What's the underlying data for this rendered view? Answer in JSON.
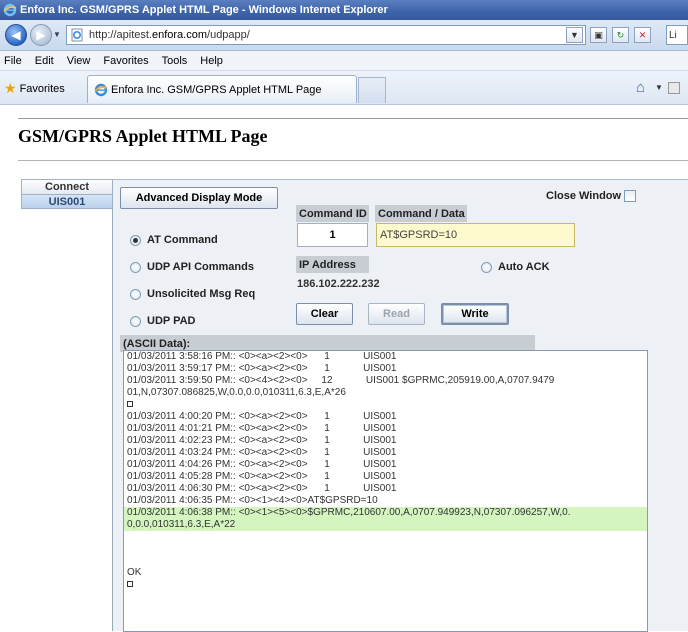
{
  "window": {
    "title": "Enfora Inc. GSM/GPRS Applet HTML Page - Windows Internet Explorer"
  },
  "address": {
    "prefix": "http://apitest.",
    "domain": "enfora.com",
    "path": "/udpapp/",
    "search_text": "Li"
  },
  "menu": [
    "File",
    "Edit",
    "View",
    "Favorites",
    "Tools",
    "Help"
  ],
  "favorites": {
    "label": "Favorites",
    "tab_title": "Enfora Inc. GSM/GPRS Applet HTML Page"
  },
  "page": {
    "title": "GSM/GPRS Applet HTML Page"
  },
  "left_tabs": [
    "Connect",
    "UIS001"
  ],
  "applet": {
    "advanced_button": "Advanced Display Mode",
    "close_window_label": "Close Window",
    "command_id_header": "Command ID",
    "command_data_header": "Command / Data",
    "command_id_value": "1",
    "command_data_value": "AT$GPSRD=10",
    "radios": {
      "at": "AT Command",
      "udp": "UDP API Commands",
      "unsol": "Unsolicited Msg Req",
      "pad": "UDP PAD",
      "ack": "Auto ACK"
    },
    "ip_header": "IP Address",
    "ip_value": "186.102.222.232",
    "clear_button": "Clear",
    "read_button": "Read",
    "write_button": "Write",
    "ascii_header": "(ASCII Data):"
  },
  "log": [
    {
      "text": "01/03/2011 3:58:16 PM:: <0><a><2><0>      1            UIS001",
      "hl": false
    },
    {
      "text": "01/03/2011 3:59:17 PM:: <0><a><2><0>      1            UIS001",
      "hl": false
    },
    {
      "text": "01/03/2011 3:59:50 PM:: <0><4><2><0>     12            UIS001 $GPRMC,205919.00,A,0707.9479",
      "hl": false
    },
    {
      "text": "01,N,07307.086825,W,0.0,0.0,010311,6.3,E,A*26",
      "hl": false
    },
    {
      "text": "",
      "hl": false,
      "box": true
    },
    {
      "text": "01/03/2011 4:00:20 PM:: <0><a><2><0>      1            UIS001",
      "hl": false
    },
    {
      "text": "01/03/2011 4:01:21 PM:: <0><a><2><0>      1            UIS001",
      "hl": false
    },
    {
      "text": "01/03/2011 4:02:23 PM:: <0><a><2><0>      1            UIS001",
      "hl": false
    },
    {
      "text": "01/03/2011 4:03:24 PM:: <0><a><2><0>      1            UIS001",
      "hl": false
    },
    {
      "text": "01/03/2011 4:04:26 PM:: <0><a><2><0>      1            UIS001",
      "hl": false
    },
    {
      "text": "01/03/2011 4:05:28 PM:: <0><a><2><0>      1            UIS001",
      "hl": false
    },
    {
      "text": "01/03/2011 4:06:30 PM:: <0><a><2><0>      1            UIS001",
      "hl": false
    },
    {
      "text": "01/03/2011 4:06:35 PM:: <0><1><4><0>AT$GPSRD=10",
      "hl": false
    },
    {
      "text": "01/03/2011 4:06:38 PM:: <0><1><5><0>$GPRMC,210607.00,A,0707.949923,N,07307.096257,W,0.",
      "hl": true
    },
    {
      "text": "0,0.0,010311,6.3,E,A*22",
      "hl": true
    },
    {
      "text": "",
      "hl": false
    },
    {
      "text": "",
      "hl": false
    },
    {
      "text": "",
      "hl": false
    },
    {
      "text": "OK",
      "hl": false
    },
    {
      "text": "",
      "hl": false,
      "box": true
    }
  ]
}
